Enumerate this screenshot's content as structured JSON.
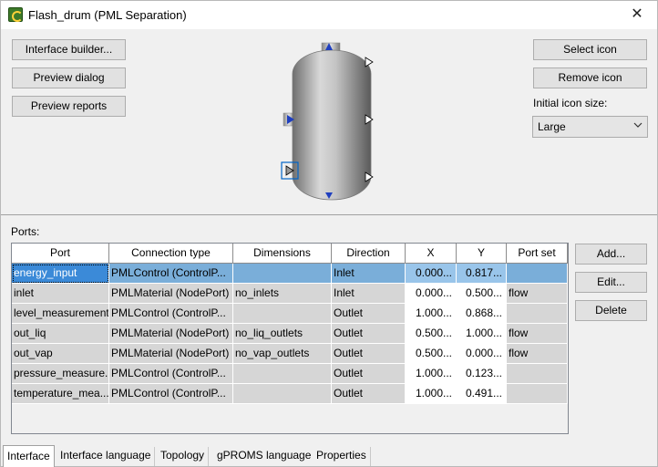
{
  "window": {
    "title": "Flash_drum  (PML Separation)",
    "close_glyph": "✕"
  },
  "left_buttons": {
    "interface_builder": "Interface builder...",
    "preview_dialog": "Preview dialog",
    "preview_reports": "Preview reports"
  },
  "right_buttons": {
    "select_icon": "Select icon",
    "remove_icon": "Remove icon",
    "icon_size_label": "Initial icon size:",
    "icon_size_value": "Large"
  },
  "ports": {
    "label": "Ports:",
    "columns": [
      "Port",
      "Connection type",
      "Dimensions",
      "Direction",
      "X",
      "Y",
      "Port set"
    ],
    "rows": [
      {
        "port": "energy_input",
        "type": "PMLControl (ControlP...",
        "dims": "",
        "direction": "Inlet",
        "x": "0.000...",
        "y": "0.817...",
        "set": ""
      },
      {
        "port": "inlet",
        "type": "PMLMaterial (NodePort)",
        "dims": "no_inlets",
        "direction": "Inlet",
        "x": "0.000...",
        "y": "0.500...",
        "set": "flow"
      },
      {
        "port": "level_measurement",
        "type": "PMLControl (ControlP...",
        "dims": "",
        "direction": "Outlet",
        "x": "1.000...",
        "y": "0.868...",
        "set": ""
      },
      {
        "port": "out_liq",
        "type": "PMLMaterial (NodePort)",
        "dims": "no_liq_outlets",
        "direction": "Outlet",
        "x": "0.500...",
        "y": "1.000...",
        "set": "flow"
      },
      {
        "port": "out_vap",
        "type": "PMLMaterial (NodePort)",
        "dims": "no_vap_outlets",
        "direction": "Outlet",
        "x": "0.500...",
        "y": "0.000...",
        "set": "flow"
      },
      {
        "port": "pressure_measure...",
        "type": "PMLControl (ControlP...",
        "dims": "",
        "direction": "Outlet",
        "x": "1.000...",
        "y": "0.123...",
        "set": ""
      },
      {
        "port": "temperature_mea...",
        "type": "PMLControl (ControlP...",
        "dims": "",
        "direction": "Outlet",
        "x": "1.000...",
        "y": "0.491...",
        "set": ""
      }
    ],
    "selected_index": 0,
    "add": "Add...",
    "edit": "Edit...",
    "delete": "Delete"
  },
  "tabs": [
    "Interface",
    "Interface language",
    "Topology",
    "gPROMS language",
    "Properties"
  ],
  "active_tab": 0,
  "icon": {
    "name": "flash-drum-vessel-icon",
    "port_marker_color": "#1f3fbf"
  }
}
